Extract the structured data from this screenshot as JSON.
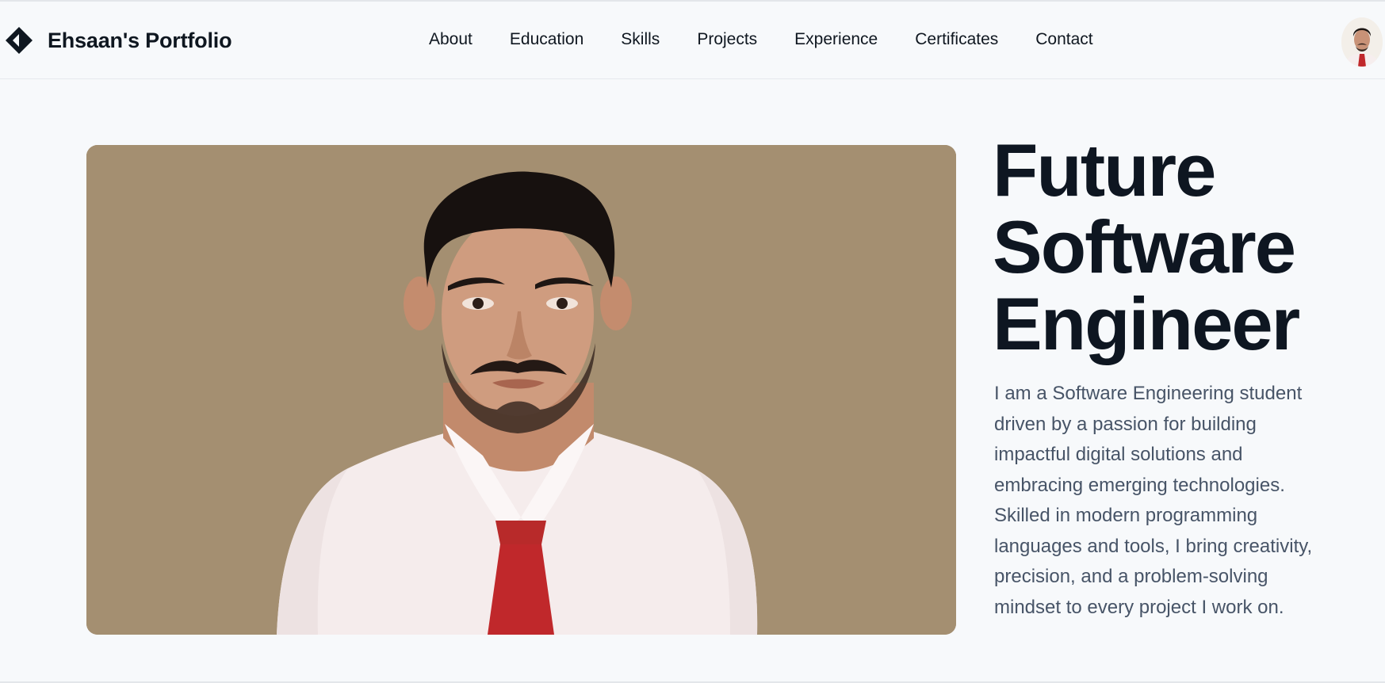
{
  "header": {
    "brand": "Ehsaan's Portfolio",
    "brand_icon": "diamond-logo-icon",
    "avatar_icon": "profile-avatar"
  },
  "nav": {
    "items": [
      {
        "label": "About"
      },
      {
        "label": "Education"
      },
      {
        "label": "Skills"
      },
      {
        "label": "Projects"
      },
      {
        "label": "Experience"
      },
      {
        "label": "Certificates"
      },
      {
        "label": "Contact"
      }
    ]
  },
  "hero": {
    "title_line1": "Future",
    "title_line2": "Software",
    "title_line3": "Engineer",
    "description": "I am a Software Engineering student driven by a passion for building impactful digital solutions and embracing emerging technologies. Skilled in modern programming languages and tools, I bring creativity, precision, and a problem-solving mindset to every project I work on.",
    "photo_background": "#a48f71"
  },
  "colors": {
    "page_background": "#f7f9fb",
    "text_primary": "#0f1720",
    "text_secondary": "#475467",
    "tie_red": "#c0282b"
  }
}
